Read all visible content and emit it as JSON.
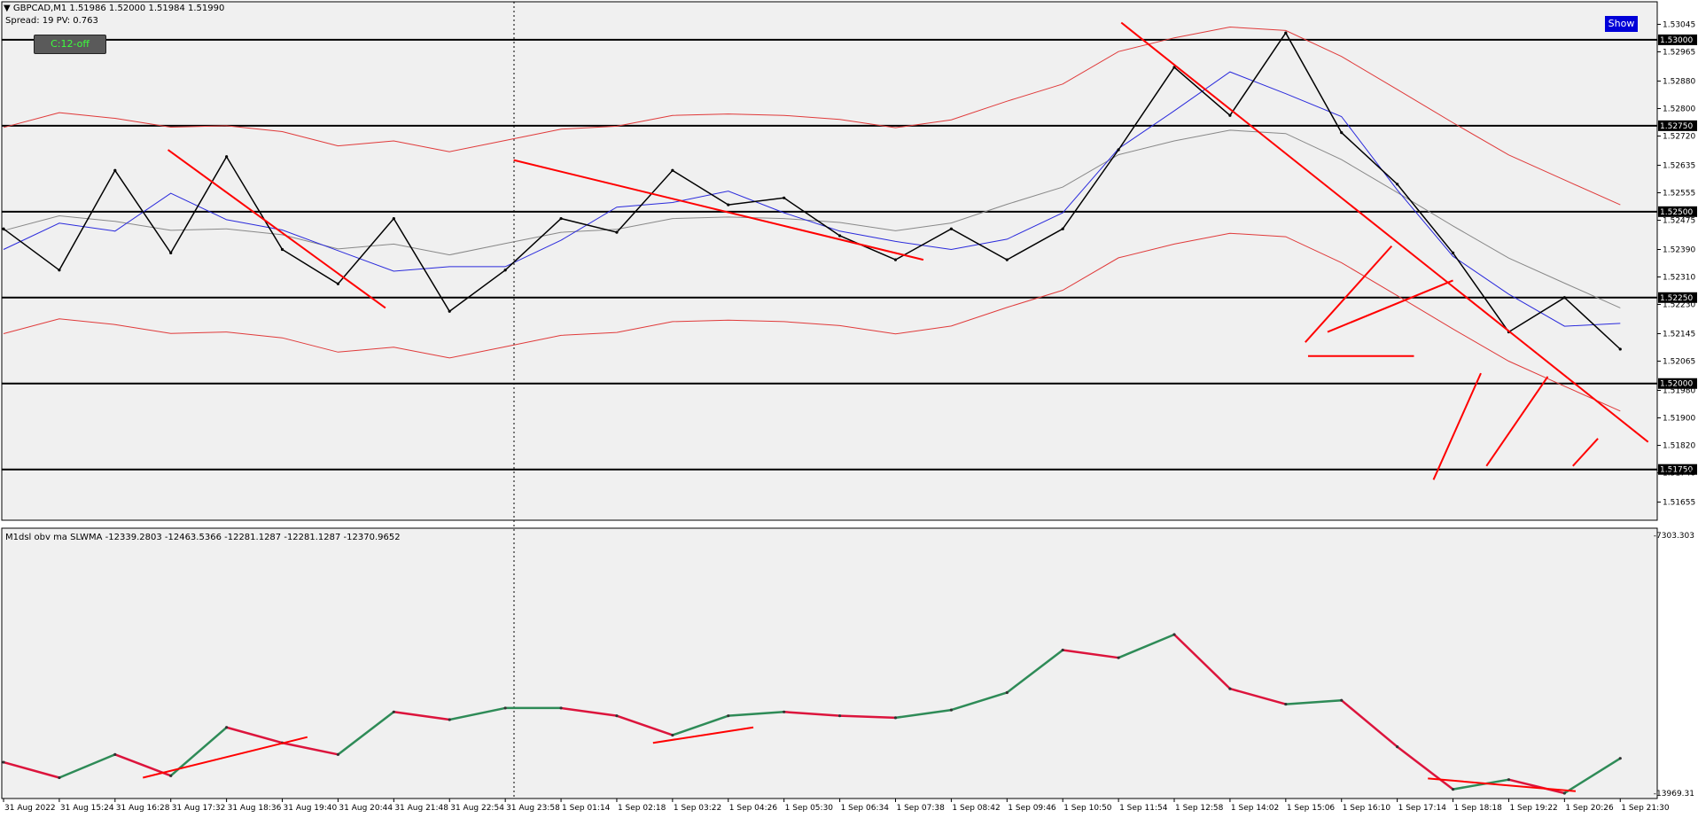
{
  "header": {
    "symbol_line": "GBPCAD,M1  1.51986 1.52000 1.51984 1.51990",
    "spread_line": "Spread: 19   PV: 0.763"
  },
  "buttons": {
    "show": "Show",
    "control": "C:12-off"
  },
  "indicator": {
    "label": "M1dsl  obv  ma  SLWMA  -12339.2803  -12463.5366  -12281.1287  -12281.1287  -12370.9652",
    "axis_top": "-7303.303",
    "axis_bottom": "-13969.31"
  },
  "colors": {
    "background": "#ffffff",
    "plot_bg": "#f0f0f0",
    "price": "#000000",
    "trendline": "#ff0000",
    "band": "#e03a3a",
    "ma_blue": "#2a2adc",
    "obv_up": "#2e8b57",
    "obv_down": "#dc143c",
    "button_show": "#0000d8",
    "button_text_control": "#3cff3c"
  },
  "chart_data": [
    {
      "type": "line",
      "name": "price",
      "ylim": [
        1.5161,
        1.5309
      ],
      "ticks_y": [
        "1.53045",
        "1.52965",
        "1.52880",
        "1.52800",
        "1.52720",
        "1.52635",
        "1.52555",
        "1.52475",
        "1.52390",
        "1.52310",
        "1.52230",
        "1.52145",
        "1.52065",
        "1.51980",
        "1.51900",
        "1.51820",
        "1.51740",
        "1.51655"
      ],
      "tick_values_y": [
        1.53045,
        1.52965,
        1.5288,
        1.528,
        1.5272,
        1.52635,
        1.52555,
        1.52475,
        1.5239,
        1.5231,
        1.5223,
        1.52145,
        1.52065,
        1.5198,
        1.519,
        1.5182,
        1.5174,
        1.51655
      ],
      "levels": [
        {
          "label": "1.53000",
          "value": 1.53
        },
        {
          "label": "1.52750",
          "value": 1.5275
        },
        {
          "label": "1.52500",
          "value": 1.525
        },
        {
          "label": "1.52250",
          "value": 1.5225
        },
        {
          "label": "1.52000",
          "value": 1.52
        },
        {
          "label": "1.51750",
          "value": 1.5175
        }
      ],
      "x": [
        0,
        2,
        4,
        6,
        8,
        10,
        12,
        14,
        16,
        18,
        20,
        22,
        24,
        26,
        28,
        30,
        32,
        34,
        36,
        38,
        40,
        42,
        44,
        46,
        48,
        50,
        52,
        54,
        56,
        58
      ],
      "y": [
        1.5245,
        1.5233,
        1.5262,
        1.5238,
        1.5266,
        1.5239,
        1.5229,
        1.5248,
        1.5221,
        1.5233,
        1.5248,
        1.5244,
        1.5262,
        1.5252,
        1.5254,
        1.5243,
        1.5236,
        1.5245,
        1.5236,
        1.5245,
        1.5268,
        1.5292,
        1.5278,
        1.5302,
        1.5273,
        1.5258,
        1.5238,
        1.5215,
        1.5225,
        1.521
      ],
      "trendlines_data": [
        [
          [
            5.9,
            1.5268
          ],
          [
            13.7,
            1.5222
          ]
        ],
        [
          [
            18.3,
            1.5265
          ],
          [
            33.0,
            1.5236
          ]
        ],
        [
          [
            40.1,
            1.5305
          ],
          [
            59.0,
            1.5183
          ]
        ],
        [
          [
            46.7,
            1.5212
          ],
          [
            49.8,
            1.524
          ]
        ],
        [
          [
            46.8,
            1.5208
          ],
          [
            50.6,
            1.5208
          ]
        ],
        [
          [
            47.5,
            1.5215
          ],
          [
            52.0,
            1.523
          ]
        ],
        [
          [
            51.3,
            1.5172
          ],
          [
            53.0,
            1.5203
          ]
        ],
        [
          [
            53.2,
            1.5176
          ],
          [
            55.4,
            1.5202
          ]
        ],
        [
          [
            56.3,
            1.5176
          ],
          [
            57.2,
            1.5184
          ]
        ]
      ],
      "x_ticks": [
        "31 Aug 2022",
        "31 Aug 15:24",
        "31 Aug 16:28",
        "31 Aug 17:32",
        "31 Aug 18:36",
        "31 Aug 19:40",
        "31 Aug 20:44",
        "31 Aug 21:48",
        "31 Aug 22:54",
        "31 Aug 23:58",
        "1 Sep 01:14",
        "1 Sep 02:18",
        "1 Sep 03:22",
        "1 Sep 04:26",
        "1 Sep 05:30",
        "1 Sep 06:34",
        "1 Sep 07:38",
        "1 Sep 08:42",
        "1 Sep 09:46",
        "1 Sep 10:50",
        "1 Sep 11:54",
        "1 Sep 12:58",
        "1 Sep 14:02",
        "1 Sep 15:06",
        "1 Sep 16:10",
        "1 Sep 17:14",
        "1 Sep 18:18",
        "1 Sep 19:22",
        "1 Sep 20:26",
        "1 Sep 21:30"
      ]
    },
    {
      "type": "line",
      "name": "obv",
      "ylim": [
        -13969.31,
        -7303.303
      ],
      "x": [
        0,
        2,
        4,
        6,
        8,
        10,
        12,
        14,
        16,
        18,
        20,
        22,
        24,
        26,
        28,
        30,
        32,
        34,
        36,
        38,
        40,
        42,
        44,
        46,
        48,
        50,
        52,
        54,
        56,
        58
      ],
      "y": [
        -13100,
        -13500,
        -12900,
        -13450,
        -12200,
        -12600,
        -12900,
        -11800,
        -12000,
        -11700,
        -11700,
        -11900,
        -12400,
        -11900,
        -11800,
        -11900,
        -11950,
        -11750,
        -11300,
        -10200,
        -10400,
        -9800,
        -11200,
        -11600,
        -11500,
        -12700,
        -13800,
        -13550,
        -13900,
        -13000
      ],
      "trendlines_data": [
        [
          [
            5.0,
            -13500
          ],
          [
            10.9,
            -12450
          ]
        ],
        [
          [
            23.3,
            -12600
          ],
          [
            26.9,
            -12200
          ]
        ],
        [
          [
            51.1,
            -13520
          ],
          [
            56.4,
            -13850
          ]
        ]
      ]
    }
  ]
}
